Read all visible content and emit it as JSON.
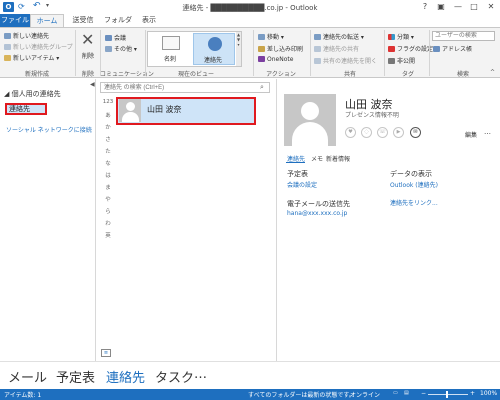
{
  "window": {
    "title": "連絡先 - ██████████.co.jp - Outlook",
    "icon_label": "O",
    "buttons": [
      "?",
      "▣",
      "—",
      "□",
      "✕"
    ]
  },
  "tabs": [
    "ファイル",
    "ホーム",
    "送受信",
    "フォルダー",
    "表示"
  ],
  "ribbon": {
    "new": {
      "items": [
        "新しい連絡先",
        "新しい連絡先グループ",
        "新しいアイテム ▾"
      ],
      "label": "新規作成"
    },
    "delete": {
      "button": "削除",
      "label": "削除"
    },
    "communication": {
      "items": [
        "会議",
        "その他 ▾"
      ],
      "label": "コミュニケーション"
    },
    "view": {
      "options": [
        "名刺",
        "連絡先"
      ],
      "label": "現在のビュー"
    },
    "actions": {
      "items": [
        "移動 ▾",
        "差し込み印刷",
        "OneNote"
      ],
      "label": "アクション"
    },
    "share": {
      "items": [
        "連絡先の転送 ▾",
        "連絡先の共有",
        "共有の連絡先を開く"
      ],
      "label": "共有"
    },
    "tags": {
      "items": [
        "分類 ▾",
        "フラグの設定 ▾",
        "非公開"
      ],
      "label": "タグ"
    },
    "find": {
      "search_placeholder": "ユーザーの検索",
      "address_book": "アドレス帳",
      "label": "検索"
    }
  },
  "nav": {
    "section": "◢ 個人用の連絡先",
    "selected": "連絡先",
    "social": "ソーシャル ネットワークに接続",
    "collapse": "◀"
  },
  "list": {
    "search_placeholder": "連絡先 の検索 (Ctrl+E)",
    "search_icon": "magnifier-icon",
    "alphabet": [
      "123",
      "あ",
      "か",
      "さ",
      "た",
      "な",
      "は",
      "ま",
      "や",
      "ら",
      "わ",
      "英"
    ],
    "contacts": [
      {
        "name": "山田 波奈"
      }
    ]
  },
  "reading": {
    "name": "山田 波奈",
    "presence": "プレゼンス情報不明",
    "edit": "編集",
    "more": "…",
    "tabs": [
      "連絡先",
      "メモ",
      "新着情報"
    ],
    "schedule_heading": "予定表",
    "schedule_link": "会議の設定",
    "email_heading": "電子メールの送信先",
    "email": "hana@xxx.xxx.co.jp",
    "data_heading": "データの表示",
    "data_source": "Outlook (連絡先)",
    "link_contacts": "連絡先をリンク..."
  },
  "bottom_nav": [
    "メール",
    "予定表",
    "連絡先",
    "タスク",
    "…"
  ],
  "status": {
    "items": "アイテム数: 1",
    "sync": "すべてのフォルダーは最新の状態です。",
    "connection": "オンライン",
    "zoom_minus": "−",
    "zoom_plus": "+",
    "zoom": "100%"
  },
  "colors": {
    "accent": "#1e6fbf",
    "highlight": "#e0191f",
    "selected_bg": "#cfe4f8"
  }
}
